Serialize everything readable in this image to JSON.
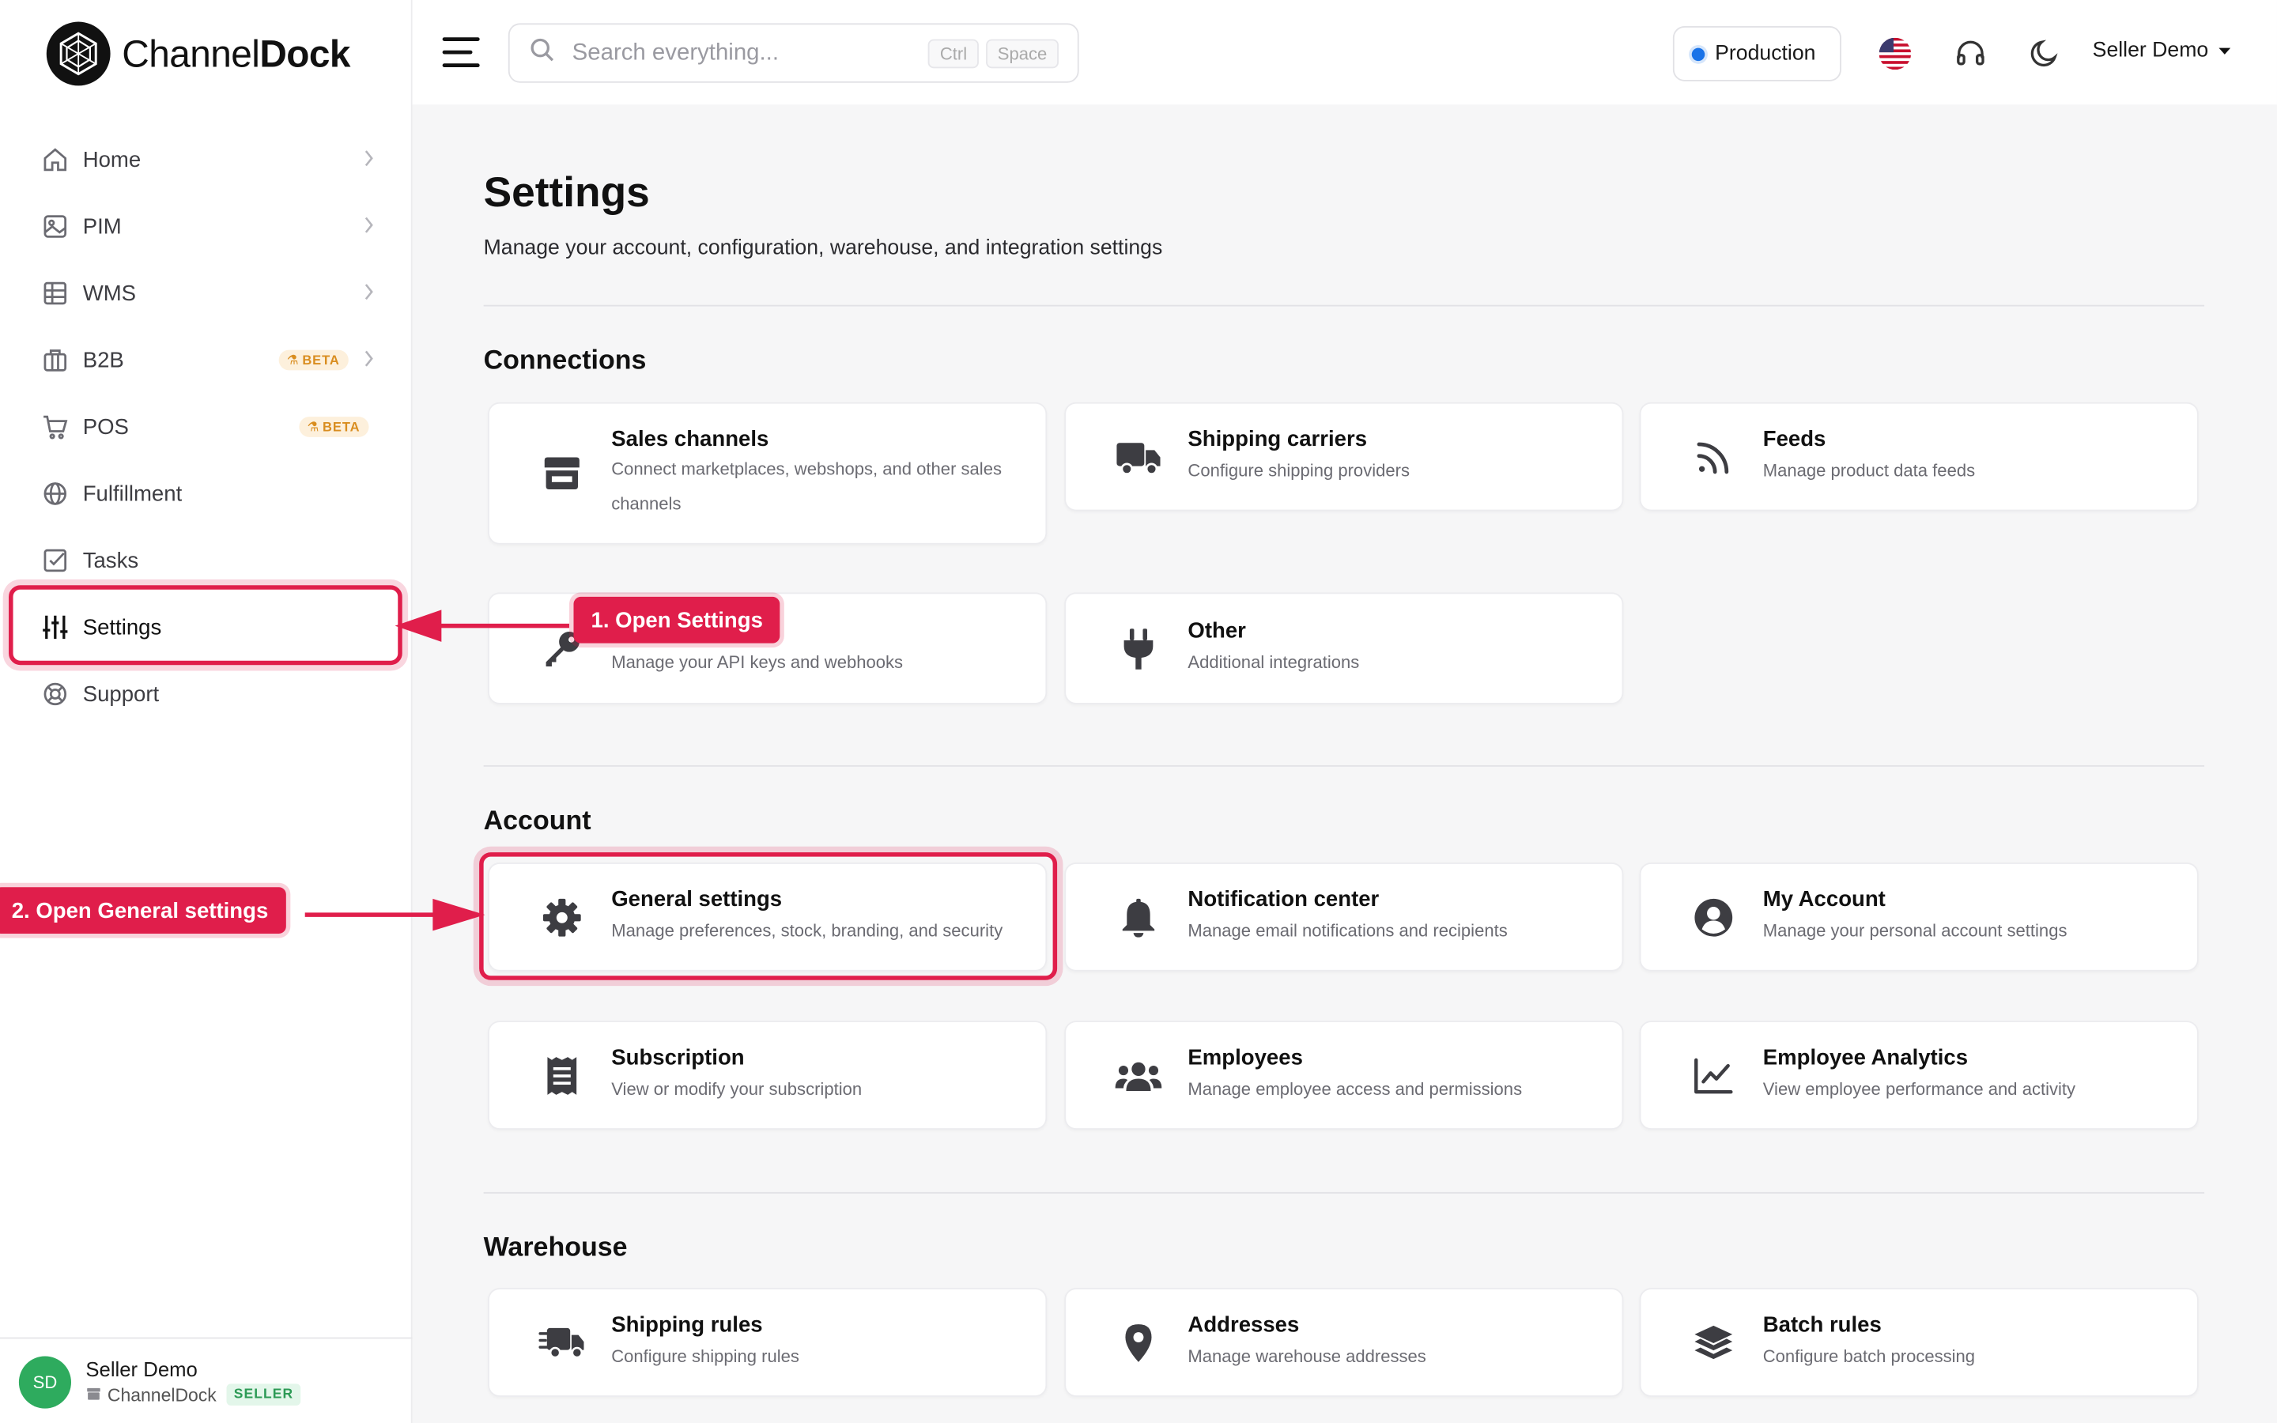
{
  "app": {
    "logo_text_a": "Channel",
    "logo_text_b": "Dock"
  },
  "header": {
    "search_placeholder": "Search everything...",
    "kbd_ctrl": "Ctrl",
    "kbd_space": "Space",
    "environment": "Production",
    "user_name": "Seller Demo"
  },
  "sidebar": {
    "items": [
      {
        "label": "Home",
        "icon": "home-icon",
        "chevron": true
      },
      {
        "label": "PIM",
        "icon": "image-icon",
        "chevron": true
      },
      {
        "label": "WMS",
        "icon": "table-icon",
        "chevron": true
      },
      {
        "label": "B2B",
        "icon": "building-icon",
        "chevron": true,
        "badge": "BETA"
      },
      {
        "label": "POS",
        "icon": "cart-icon",
        "badge": "BETA"
      },
      {
        "label": "Fulfillment",
        "icon": "globe-icon"
      },
      {
        "label": "Tasks",
        "icon": "checkbox-icon"
      },
      {
        "label": "Settings",
        "icon": "sliders-icon",
        "active": true
      },
      {
        "label": "Support",
        "icon": "lifebuoy-icon"
      }
    ],
    "profile": {
      "initials": "SD",
      "name": "Seller Demo",
      "org": "ChannelDock",
      "role": "SELLER"
    }
  },
  "main": {
    "title": "Settings",
    "subtitle": "Manage your account, configuration, warehouse, and integration settings",
    "sections": [
      {
        "title": "Connections",
        "cards": [
          {
            "title": "Sales channels",
            "desc": "Connect marketplaces, webshops, and other sales channels",
            "icon": "store-icon"
          },
          {
            "title": "Shipping carriers",
            "desc": "Configure shipping providers",
            "icon": "truck-icon"
          },
          {
            "title": "Feeds",
            "desc": "Manage product data feeds",
            "icon": "rss-icon"
          },
          {
            "title": "",
            "desc": "Manage your API keys and webhooks",
            "icon": "key-icon"
          },
          {
            "title": "Other",
            "desc": "Additional integrations",
            "icon": "plug-icon"
          }
        ]
      },
      {
        "title": "Account",
        "cards": [
          {
            "title": "General settings",
            "desc": "Manage preferences, stock, branding, and security",
            "icon": "gear-icon"
          },
          {
            "title": "Notification center",
            "desc": "Manage email notifications and recipients",
            "icon": "bell-icon"
          },
          {
            "title": "My Account",
            "desc": "Manage your personal account settings",
            "icon": "user-circle-icon"
          },
          {
            "title": "Subscription",
            "desc": "View or modify your subscription",
            "icon": "receipt-icon"
          },
          {
            "title": "Employees",
            "desc": "Manage employee access and permissions",
            "icon": "users-icon"
          },
          {
            "title": "Employee Analytics",
            "desc": "View employee performance and activity",
            "icon": "chart-line-icon"
          }
        ]
      },
      {
        "title": "Warehouse",
        "cards": [
          {
            "title": "Shipping rules",
            "desc": "Configure shipping rules",
            "icon": "fast-truck-icon"
          },
          {
            "title": "Addresses",
            "desc": "Manage warehouse addresses",
            "icon": "map-pin-icon"
          },
          {
            "title": "Batch rules",
            "desc": "Configure batch processing",
            "icon": "layers-icon"
          }
        ]
      }
    ]
  },
  "annotations": {
    "step1": "1. Open Settings",
    "step2": "2. Open General settings"
  },
  "colors": {
    "accent": "#e01e4b",
    "env_dot": "#1a73e8",
    "avatar": "#2eab5e",
    "beta_bg": "#fdf0dc",
    "beta_fg": "#d98d1f"
  }
}
